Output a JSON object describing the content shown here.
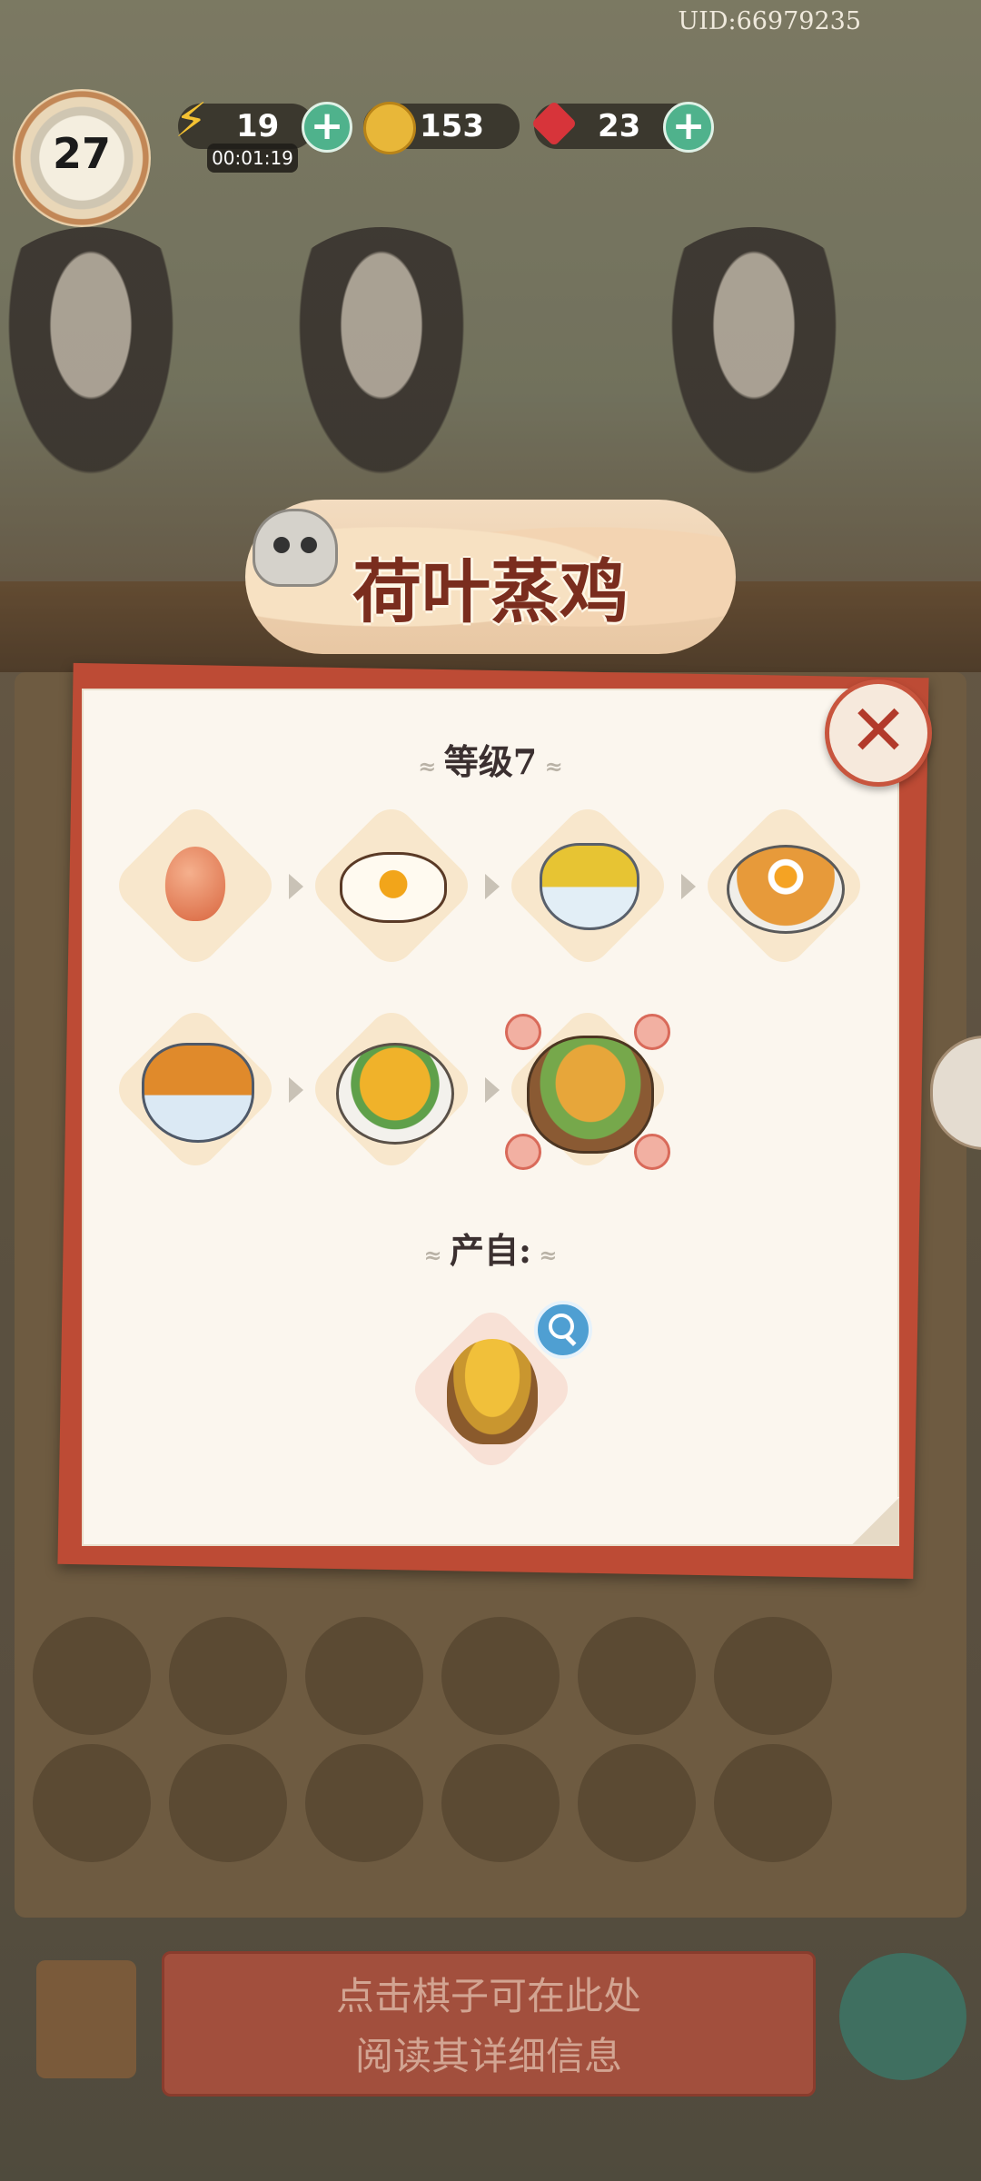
{
  "hud": {
    "uid": "UID:66979235",
    "level": "27",
    "energy": "19",
    "energy_timer": "00:01:19",
    "coins": "153",
    "gems": "23"
  },
  "popup": {
    "title": "荷叶蒸鸡",
    "level_label": "等级7",
    "source_label": "产自:",
    "chain_items": [
      {
        "icon": "egg-icon"
      },
      {
        "icon": "fried-egg-icon"
      },
      {
        "icon": "egg-fried-rice-bowl-icon"
      },
      {
        "icon": "egg-rice-plate-icon"
      },
      {
        "icon": "chicken-rice-bowl-icon"
      },
      {
        "icon": "roast-chicken-plate-icon"
      },
      {
        "icon": "lotus-leaf-steamed-chicken-icon"
      }
    ],
    "source_item": {
      "icon": "hen-on-nest-icon"
    }
  },
  "bottom": {
    "hint_line1": "点击棋子可在此处",
    "hint_line2": "阅读其详细信息"
  },
  "colors": {
    "panel_border": "#bd4b35",
    "panel_bg": "#fbf6ee",
    "title_text": "#7a2d1e",
    "plus_button": "#4fb28c"
  }
}
